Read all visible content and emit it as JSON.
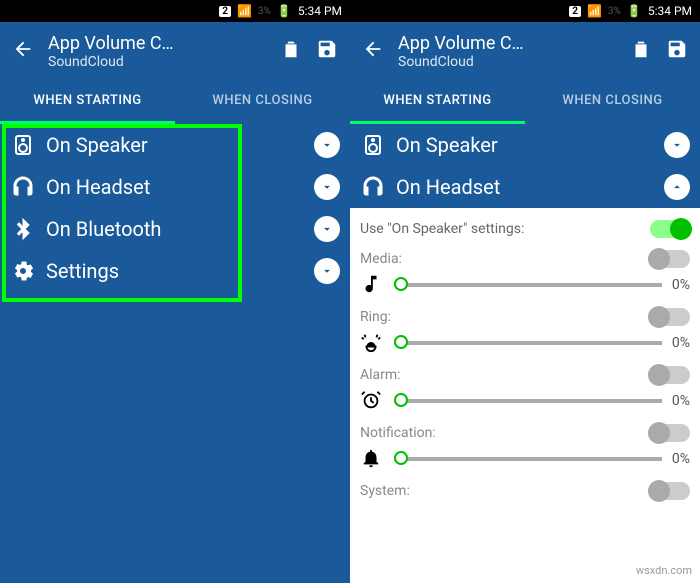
{
  "statusbar": {
    "sim": "2",
    "battery": "3%",
    "time": "5:34 PM"
  },
  "appbar": {
    "title": "App Volume C…",
    "subtitle": "SoundCloud"
  },
  "tabs": {
    "starting": "WHEN STARTING",
    "closing": "WHEN CLOSING"
  },
  "options": {
    "speaker": "On Speaker",
    "headset": "On Headset",
    "bluetooth": "On Bluetooth",
    "settings": "Settings"
  },
  "panel": {
    "useSpeaker": "Use \"On Speaker\" settings:",
    "media": {
      "label": "Media:",
      "value": "0%"
    },
    "ring": {
      "label": "Ring:",
      "value": "0%"
    },
    "alarm": {
      "label": "Alarm:",
      "value": "0%"
    },
    "notification": {
      "label": "Notification:",
      "value": "0%"
    },
    "system": {
      "label": "System:"
    }
  },
  "watermark": "wsxdn.com"
}
